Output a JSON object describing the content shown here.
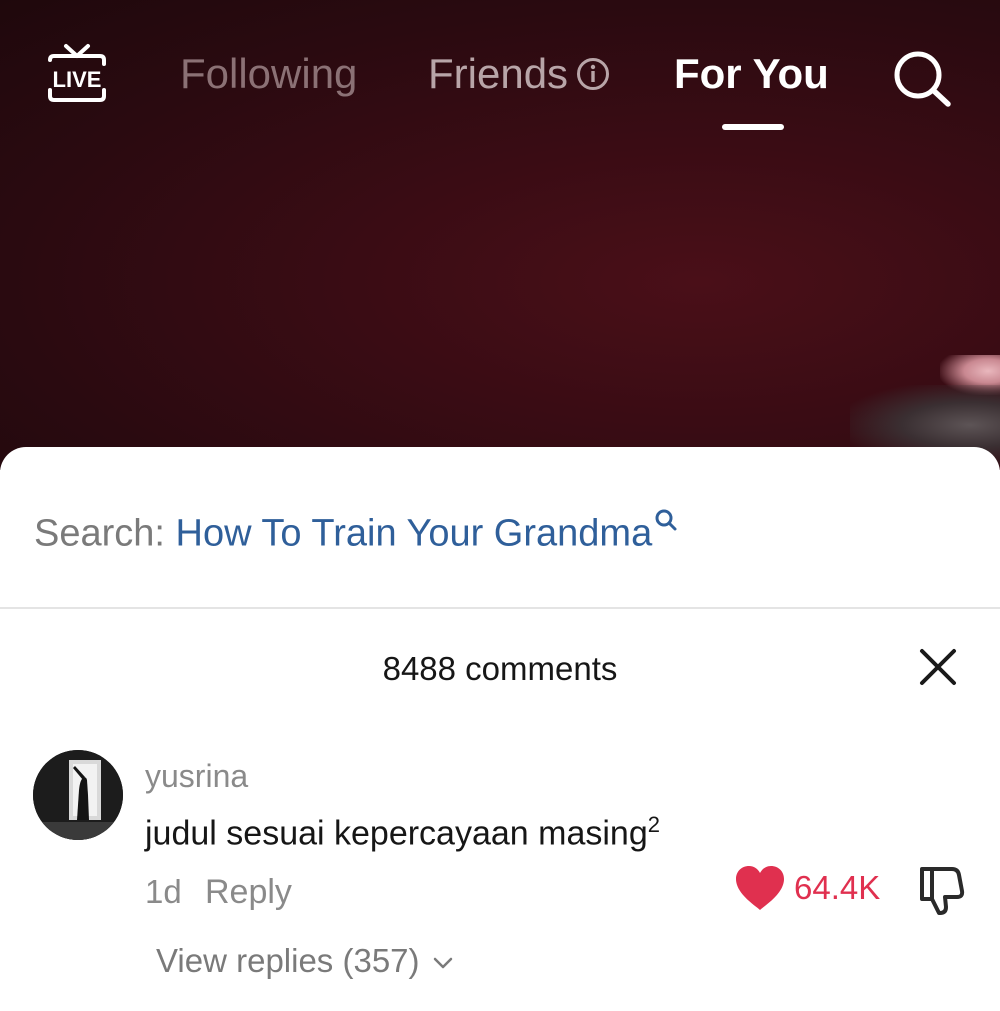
{
  "nav": {
    "live_label": "LIVE",
    "tabs": [
      {
        "label": "Following"
      },
      {
        "label": "Friends"
      },
      {
        "label": "For You"
      }
    ],
    "active_tab": "For You",
    "icons": {
      "live": "live-tv-icon",
      "info": "info-icon",
      "search": "search-icon"
    }
  },
  "comments_sheet": {
    "search_prefix": "Search: ",
    "search_term": "How To Train Your Grandma",
    "count_label": "8488 comments",
    "comment": {
      "username": "yusrina",
      "text": "judul sesuai kepercayaan masing",
      "superscript": "2",
      "time": "1d",
      "reply_label": "Reply",
      "like_count": "64.4K",
      "view_replies_label": "View replies (357)"
    }
  },
  "colors": {
    "accent_like": "#e0304f",
    "search_link": "#2f5f9a"
  }
}
